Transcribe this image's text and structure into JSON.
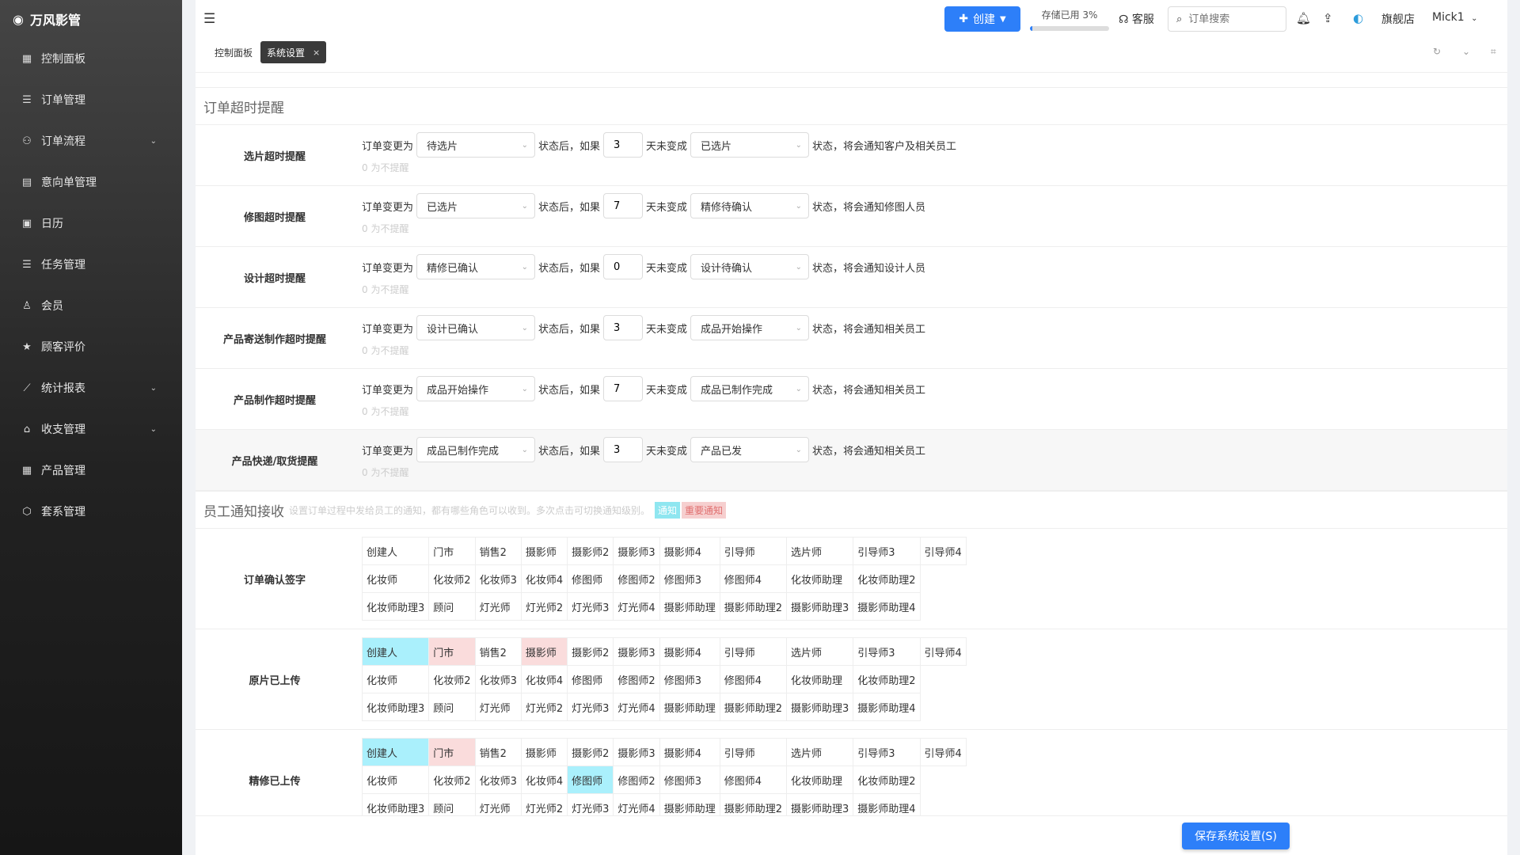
{
  "app": {
    "name": "万风影管"
  },
  "sidebar": {
    "items": [
      {
        "label": "控制面板",
        "icon": "grid-icon"
      },
      {
        "label": "订单管理",
        "icon": "list-icon"
      },
      {
        "label": "订单流程",
        "icon": "flow-icon"
      },
      {
        "label": "意向单管理",
        "icon": "doc-icon"
      },
      {
        "label": "日历",
        "icon": "calendar-icon"
      },
      {
        "label": "任务管理",
        "icon": "list-icon"
      },
      {
        "label": "会员",
        "icon": "user-icon"
      },
      {
        "label": "顾客评价",
        "icon": "star-icon"
      },
      {
        "label": "统计报表",
        "icon": "chart-icon"
      },
      {
        "label": "收支管理",
        "icon": "bank-icon"
      },
      {
        "label": "产品管理",
        "icon": "grid-icon"
      },
      {
        "label": "套系管理",
        "icon": "package-icon"
      }
    ]
  },
  "header": {
    "create_label": "创建",
    "storage_label": "存储已用 3%",
    "storage_used": 0.03,
    "service_label": "客服",
    "search_placeholder": "订单搜索",
    "store_label": "旗舰店",
    "user_label": "Mick1"
  },
  "tabs": [
    {
      "label": "控制面板"
    },
    {
      "label": "系统设置"
    }
  ],
  "timeout": {
    "title": "订单超时提醒",
    "prefix": "订单变更为",
    "mid": "状态后，如果",
    "days_text": "天未变成",
    "hint": "0 为不提醒",
    "rows": [
      {
        "label": "选片超时提醒",
        "from": "待选片",
        "days": "3",
        "to": "已选片",
        "suffix": "状态，将会通知客户及相关员工"
      },
      {
        "label": "修图超时提醒",
        "from": "已选片",
        "days": "7",
        "to": "精修待确认",
        "suffix": "状态，将会通知修图人员"
      },
      {
        "label": "设计超时提醒",
        "from": "精修已确认",
        "days": "0",
        "to": "设计待确认",
        "suffix": "状态，将会通知设计人员"
      },
      {
        "label": "产品寄送制作超时提醒",
        "from": "设计已确认",
        "days": "3",
        "to": "成品开始操作",
        "suffix": "状态，将会通知相关员工"
      },
      {
        "label": "产品制作超时提醒",
        "from": "成品开始操作",
        "days": "7",
        "to": "成品已制作完成",
        "suffix": "状态，将会通知相关员工"
      },
      {
        "label": "产品快递/取货提醒",
        "from": "成品已制作完成",
        "days": "3",
        "to": "产品已发",
        "suffix": "状态，将会通知相关员工"
      }
    ]
  },
  "notify": {
    "title": "员工通知接收",
    "desc": "设置订单过程中发给员工的通知，都有哪些角色可以收到。多次点击可切换通知级别。",
    "tag_notify": "通知",
    "tag_important": "重要通知",
    "colors": {
      "notify": "#aaf0fc",
      "important": "#fadcdc"
    },
    "roles": [
      [
        "创建人",
        "门市",
        "销售2",
        "摄影师",
        "摄影师2",
        "摄影师3",
        "摄影师4",
        "引导师",
        "选片师",
        "引导师3",
        "引导师4"
      ],
      [
        "化妆师",
        "化妆师2",
        "化妆师3",
        "化妆师4",
        "修图师",
        "修图师2",
        "修图师3",
        "修图师4",
        "化妆师助理",
        "化妆师助理2"
      ],
      [
        "化妆师助理3",
        "顾问",
        "灯光师",
        "灯光师2",
        "灯光师3",
        "灯光师4",
        "摄影师助理",
        "摄影师助理2",
        "摄影师助理3",
        "摄影师助理4"
      ]
    ],
    "rows": [
      {
        "label": "订单确认签字",
        "notified": [],
        "important": []
      },
      {
        "label": "原片已上传",
        "notified": [
          "创建人"
        ],
        "important": [
          "门市",
          "摄影师"
        ]
      },
      {
        "label": "精修已上传",
        "notified": [
          "创建人",
          "修图师"
        ],
        "important": [
          "门市"
        ]
      }
    ]
  },
  "footer": {
    "save_label": "保存系统设置(S)"
  }
}
